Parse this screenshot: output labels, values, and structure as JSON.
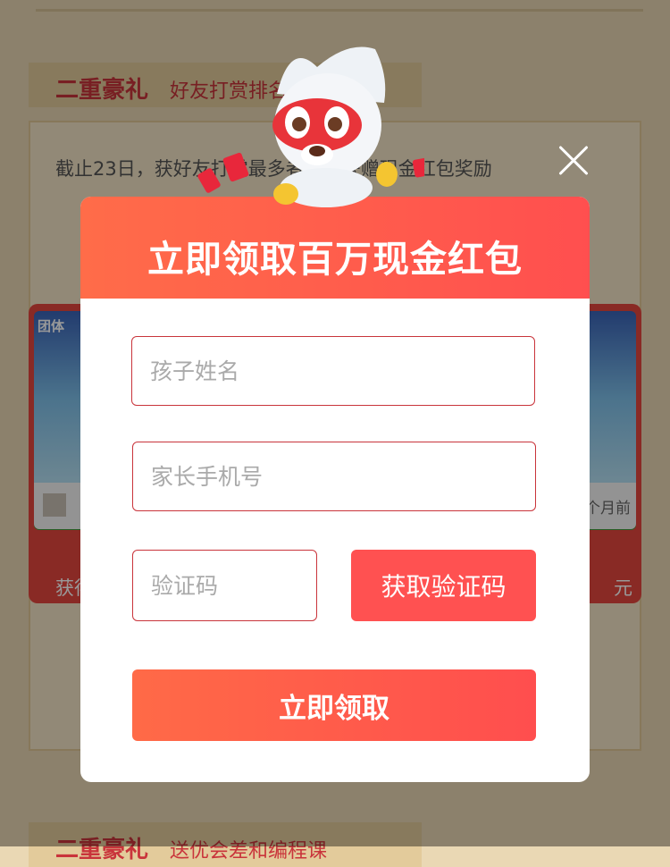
{
  "background": {
    "section1": {
      "title": "二重豪礼",
      "subtitle": "好友打赏排名"
    },
    "description": "截止23日，获好友打赏最多者，将获赠现金红包奖励",
    "card_left": {
      "tag": "团体",
      "caption": "获得"
    },
    "card_right": {
      "time": "1个月前",
      "caption": "元"
    },
    "section2": {
      "title": "二重豪礼",
      "subtitle": "送优会差和编程课"
    }
  },
  "modal": {
    "title": "立即领取百万现金红包",
    "child_name": {
      "placeholder": "孩子姓名",
      "value": ""
    },
    "parent_phone": {
      "placeholder": "家长手机号",
      "value": ""
    },
    "verify_code": {
      "placeholder": "验证码",
      "value": ""
    },
    "get_code_button": "获取验证码",
    "claim_button": "立即领取"
  },
  "colors": {
    "accent": "#ff5151",
    "brand_red": "#c9343b",
    "header_gradient_start": "#ff6c49"
  },
  "icons": {
    "close": "close-icon",
    "mascot": "dog-mascot-icon"
  }
}
